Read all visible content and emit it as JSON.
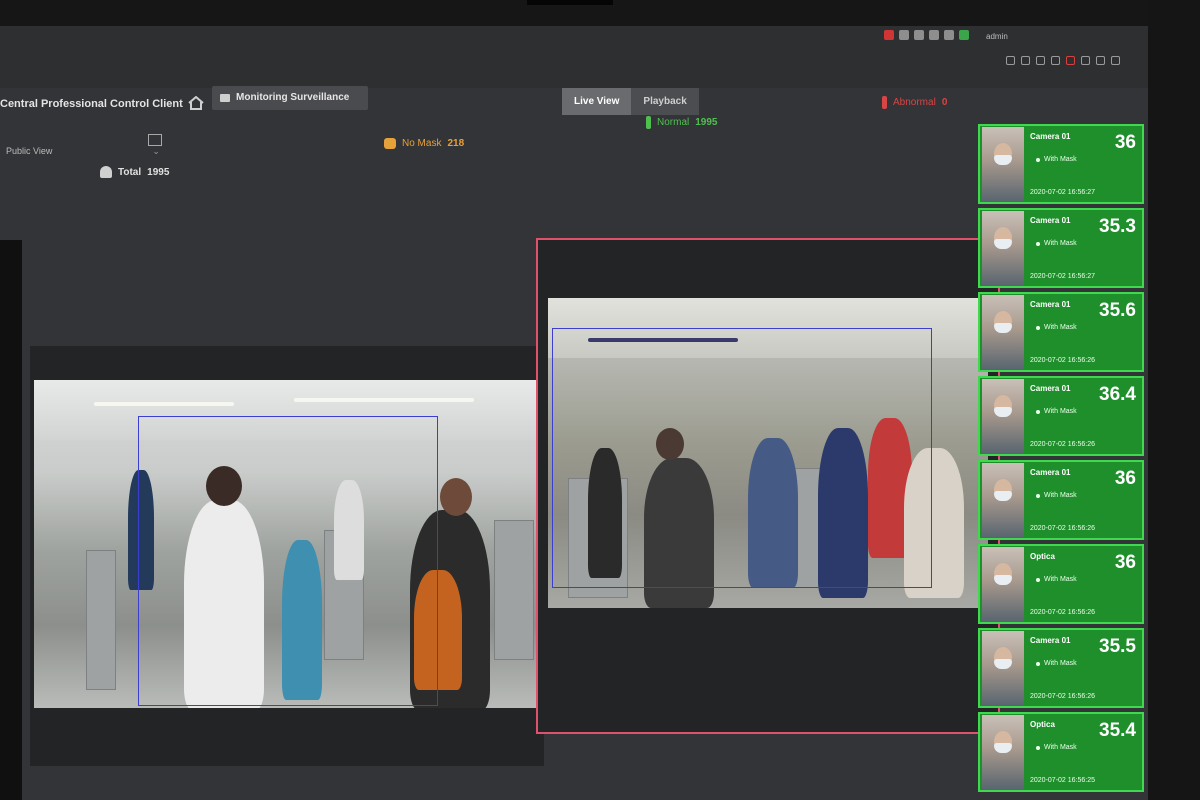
{
  "app": {
    "title": "Central Professional Control Client",
    "tab_label": "Monitoring Surveillance",
    "user": "admin"
  },
  "mode_switch": {
    "live": "Live View",
    "playback": "Playback"
  },
  "view_select": {
    "label": "Public View",
    "chevron": "⌄"
  },
  "stats": {
    "total_label": "Total",
    "total_value": "1995",
    "no_mask_label": "No Mask",
    "no_mask_value": "218",
    "normal_label": "Normal",
    "normal_value": "1995",
    "abnormal_label": "Abnormal",
    "abnormal_value": "0"
  },
  "colors": {
    "accent_green": "#3fd84e",
    "card_bg": "#1f8f2c",
    "alarm_red": "#e0516e",
    "warn_orange": "#e6a13a"
  },
  "records": [
    {
      "camera": "Camera 01",
      "temp": "36",
      "mask": "With Mask",
      "time": "2020-07-02 16:56:27"
    },
    {
      "camera": "Camera 01",
      "temp": "35.3",
      "mask": "With Mask",
      "time": "2020-07-02 16:56:27"
    },
    {
      "camera": "Camera 01",
      "temp": "35.6",
      "mask": "With Mask",
      "time": "2020-07-02 16:56:26"
    },
    {
      "camera": "Camera 01",
      "temp": "36.4",
      "mask": "With Mask",
      "time": "2020-07-02 16:56:26"
    },
    {
      "camera": "Camera 01",
      "temp": "36",
      "mask": "With Mask",
      "time": "2020-07-02 16:56:26"
    },
    {
      "camera": "Optica",
      "temp": "36",
      "mask": "With Mask",
      "time": "2020-07-02 16:56:26"
    },
    {
      "camera": "Camera 01",
      "temp": "35.5",
      "mask": "With Mask",
      "time": "2020-07-02 16:56:26"
    },
    {
      "camera": "Optica",
      "temp": "35.4",
      "mask": "With Mask",
      "time": "2020-07-02 16:56:25"
    }
  ]
}
